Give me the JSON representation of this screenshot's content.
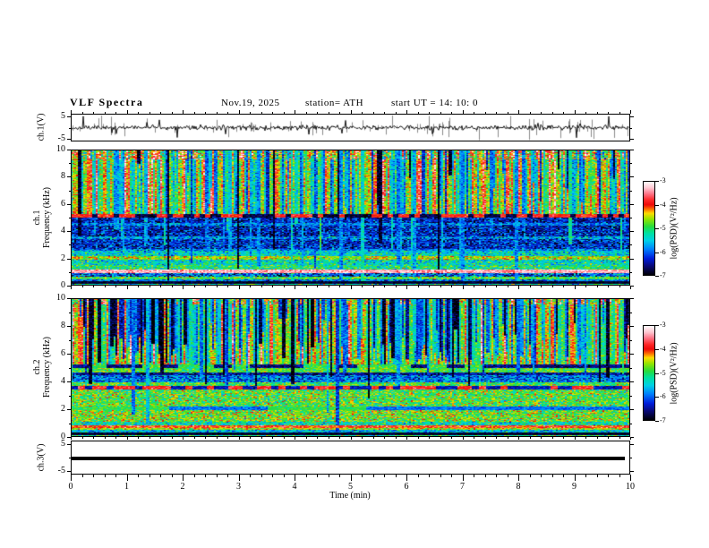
{
  "figure": {
    "title": "VLF Spectra",
    "date": "Nov.19, 2025",
    "station": "station= ATH",
    "start_ut": "start UT  =   14: 10: 0",
    "background": "#ffffff"
  },
  "x_axis": {
    "label": "Time  (min)",
    "ticks": [
      0,
      1,
      2,
      3,
      4,
      5,
      6,
      7,
      8,
      9,
      10
    ],
    "minor_step": 0.2,
    "range": [
      0,
      10
    ]
  },
  "colorbar": {
    "label": "log(PSD)(V²/Hz)",
    "ticks": [
      -3,
      -4,
      -5,
      -6,
      -7
    ],
    "range": [
      -7,
      -3
    ],
    "stops": [
      [
        0.0,
        0,
        0,
        0
      ],
      [
        0.1,
        10,
        10,
        120
      ],
      [
        0.18,
        0,
        30,
        220
      ],
      [
        0.28,
        0,
        130,
        255
      ],
      [
        0.37,
        0,
        210,
        230
      ],
      [
        0.45,
        0,
        225,
        160
      ],
      [
        0.52,
        40,
        220,
        60
      ],
      [
        0.6,
        150,
        230,
        0
      ],
      [
        0.66,
        255,
        220,
        0
      ],
      [
        0.7,
        255,
        120,
        0
      ],
      [
        0.75,
        238,
        10,
        10
      ],
      [
        0.8,
        255,
        40,
        40
      ],
      [
        0.87,
        255,
        120,
        140
      ],
      [
        0.93,
        255,
        200,
        210
      ],
      [
        1.0,
        255,
        255,
        255
      ]
    ]
  },
  "chart_data": [
    {
      "id": "ch1_waveform",
      "type": "line",
      "ylabel": "ch.1(V)",
      "ylim": [
        -6.2,
        6.2
      ],
      "yticks": [
        5,
        -5
      ],
      "xlim": [
        0,
        10
      ],
      "signal": {
        "baseline": 0,
        "noise_sd": 0.5,
        "gray_spike_count": 140,
        "black_spike_prob": 0.05,
        "spike_max_v": 5.4,
        "trace_color": "#000000",
        "spike_color": "#8a8a8a"
      }
    },
    {
      "id": "ch1_spectrogram",
      "type": "heatmap",
      "ylabel_line1": "ch.1",
      "ylabel_line2": "Frequency  (kHz)",
      "ylim": [
        0,
        10
      ],
      "yticks": [
        0,
        2,
        4,
        6,
        8,
        10
      ],
      "xlim": [
        0,
        10
      ],
      "value_range": [
        -7,
        -3
      ],
      "bands": [
        {
          "f": [
            9.3,
            10.01
          ],
          "v": -4.35,
          "n": 0.55,
          "col": 0.35
        },
        {
          "f": [
            5.28,
            9.3
          ],
          "v": -4.7,
          "n": 0.32,
          "col": 0.45
        },
        {
          "f": [
            5.02,
            5.28
          ],
          "dash": [
            -3.9,
            -6.8,
            3
          ],
          "n": 0.3,
          "keep": true
        },
        {
          "f": [
            4.6,
            5.02
          ],
          "v": -6.35,
          "n": 0.38
        },
        {
          "f": [
            4.42,
            4.6
          ],
          "v": -5.85,
          "n": 0.35
        },
        {
          "f": [
            3.6,
            4.42
          ],
          "v": -6.35,
          "n": 0.42
        },
        {
          "f": [
            3.38,
            3.6
          ],
          "v": -5.8,
          "n": 0.4
        },
        {
          "f": [
            2.68,
            3.38
          ],
          "v": -6.3,
          "n": 0.42
        },
        {
          "f": [
            2.52,
            2.68
          ],
          "v": -5.85,
          "n": 0.35
        },
        {
          "f": [
            2.18,
            2.52
          ],
          "v": -5.45,
          "n": 0.38
        },
        {
          "f": [
            1.9,
            2.18
          ],
          "v": -4.55,
          "n": 0.32
        },
        {
          "f": [
            1.48,
            1.9
          ],
          "v": -5.35,
          "n": 0.4
        },
        {
          "f": [
            1.18,
            1.48
          ],
          "v": -5.1,
          "n": 0.38
        },
        {
          "f": [
            0.92,
            1.18
          ],
          "v": -3.35,
          "n": 0.22,
          "keep": true
        },
        {
          "f": [
            0.64,
            0.92
          ],
          "v": -6.05,
          "n": 0.5
        },
        {
          "f": [
            0.46,
            0.64
          ],
          "v": -4.9,
          "n": 0.35
        },
        {
          "f": [
            0.3,
            0.46
          ],
          "v": -5.9,
          "n": 0.4
        },
        {
          "f": [
            0.12,
            0.3
          ],
          "v": -6.85,
          "n": 0.12,
          "keep": true
        },
        {
          "f": [
            0,
            0.12
          ],
          "v": -5.3,
          "n": 0.45
        }
      ],
      "streaks": {
        "count": 120,
        "v": -5.75,
        "n": 0.35,
        "black_frac": 0.12,
        "stops": [
          [
            4.9,
            9.0,
            0.62
          ],
          [
            2.4,
            4.9,
            0.24
          ],
          [
            0.1,
            2.4,
            0.14
          ]
        ],
        "clusters": []
      }
    },
    {
      "id": "ch2_spectrogram",
      "type": "heatmap",
      "ylabel_line1": "ch.2",
      "ylabel_line2": "Frequency  (kHz)",
      "ylim": [
        0,
        10
      ],
      "yticks": [
        0,
        2,
        4,
        6,
        8,
        10
      ],
      "xlim": [
        0,
        10
      ],
      "value_range": [
        -7,
        -3
      ],
      "bands": [
        {
          "f": [
            9.55,
            10.01
          ],
          "v": -4.45,
          "n": 0.5,
          "col": 0.3
        },
        {
          "f": [
            5.22,
            9.55
          ],
          "v": -4.75,
          "n": 0.3,
          "col": 0.4
        },
        {
          "f": [
            4.95,
            5.22
          ],
          "dash": [
            -4.9,
            -6.6,
            10
          ],
          "n": 0.35
        },
        {
          "f": [
            4.64,
            4.95
          ],
          "v": -4.85,
          "n": 0.3
        },
        {
          "f": [
            4.46,
            4.64
          ],
          "v": -6.5,
          "n": 0.3
        },
        {
          "f": [
            3.96,
            4.46
          ],
          "v": -5.95,
          "n": 0.42
        },
        {
          "f": [
            3.64,
            3.96
          ],
          "v": -4.9,
          "n": 0.35
        },
        {
          "f": [
            3.44,
            3.64
          ],
          "dash": [
            -3.85,
            -6.4,
            4
          ],
          "n": 0.3,
          "keep": true
        },
        {
          "f": [
            2.2,
            3.44
          ],
          "v": -4.85,
          "n": 0.4
        },
        {
          "f": [
            1.94,
            2.2
          ],
          "dash": [
            -4.95,
            -5.95,
            55
          ],
          "n": 0.3
        },
        {
          "f": [
            1.06,
            1.94
          ],
          "v": -4.72,
          "n": 0.4
        },
        {
          "f": [
            0.84,
            1.06
          ],
          "v": -5.3,
          "n": 0.4
        },
        {
          "f": [
            0.62,
            0.84
          ],
          "v": -3.95,
          "n": 0.3,
          "keep": true
        },
        {
          "f": [
            0.46,
            0.62
          ],
          "v": -4.55,
          "n": 0.3
        },
        {
          "f": [
            0.3,
            0.46
          ],
          "v": -5.6,
          "n": 0.4
        },
        {
          "f": [
            0.1,
            0.3
          ],
          "v": -6.85,
          "n": 0.1,
          "keep": true
        },
        {
          "f": [
            0,
            0.1
          ],
          "v": -5.1,
          "n": 0.4
        }
      ],
      "streaks": {
        "count": 150,
        "v": -6.0,
        "n": 0.45,
        "black_frac": 0.18,
        "stops": [
          [
            5.3,
            8.8,
            0.7
          ],
          [
            3.5,
            5.3,
            0.2
          ],
          [
            0.3,
            3.5,
            0.1
          ]
        ],
        "clusters": [
          [
            0.08,
            0.2,
            35
          ],
          [
            0.55,
            0.72,
            55
          ]
        ]
      }
    },
    {
      "id": "ch3_waveform",
      "type": "line",
      "ylabel": "ch.3(V)",
      "ylim": [
        -6.2,
        6.2
      ],
      "yticks": [
        5,
        -5
      ],
      "xlim": [
        0,
        10
      ],
      "flat": {
        "value": -0.3,
        "thickness": 4,
        "x_end_frac": 0.991,
        "color": "#000000"
      }
    }
  ]
}
